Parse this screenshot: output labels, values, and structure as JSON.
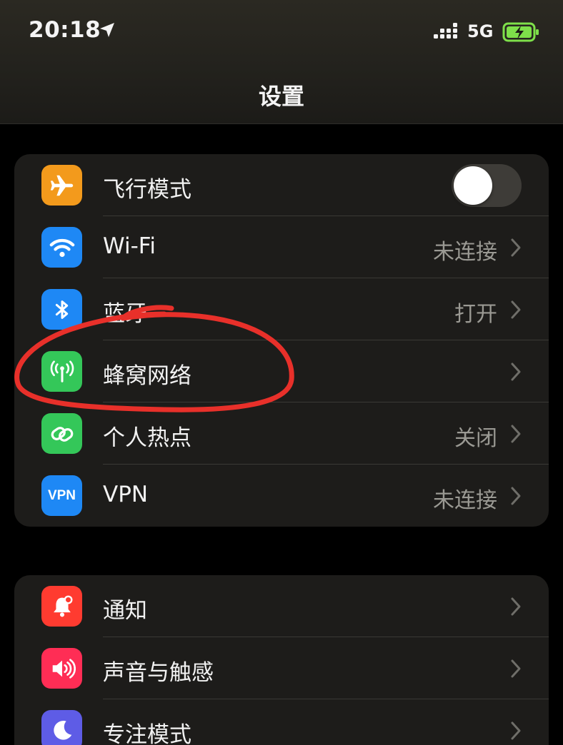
{
  "status_bar": {
    "time": "20:18",
    "network": "5G",
    "battery_color": "#7ee04a"
  },
  "header": {
    "title": "设置"
  },
  "colors": {
    "orange": "#f39a1c",
    "blue": "#1e88f5",
    "green": "#34c759",
    "red": "#ff3b30",
    "pink": "#ff2d55",
    "purple": "#5e5ce6",
    "annotation": "#e8302a"
  },
  "groups": [
    {
      "rows": [
        {
          "label": "飞行模式",
          "icon": "airplane-icon",
          "control": "toggle",
          "toggle_on": false
        },
        {
          "label": "Wi-Fi",
          "icon": "wifi-icon",
          "value": "未连接"
        },
        {
          "label": "蓝牙",
          "icon": "bluetooth-icon",
          "value": "打开"
        },
        {
          "label": "蜂窝网络",
          "icon": "antenna-icon",
          "value": ""
        },
        {
          "label": "个人热点",
          "icon": "hotspot-link-icon",
          "value": "关闭"
        },
        {
          "label": "VPN",
          "icon": "vpn-icon",
          "icon_text": "VPN",
          "value": "未连接"
        }
      ]
    },
    {
      "rows": [
        {
          "label": "通知",
          "icon": "notification-bell-icon",
          "value": ""
        },
        {
          "label": "声音与触感",
          "icon": "speaker-icon",
          "value": ""
        },
        {
          "label": "专注模式",
          "icon": "moon-icon",
          "value": ""
        }
      ]
    }
  ]
}
